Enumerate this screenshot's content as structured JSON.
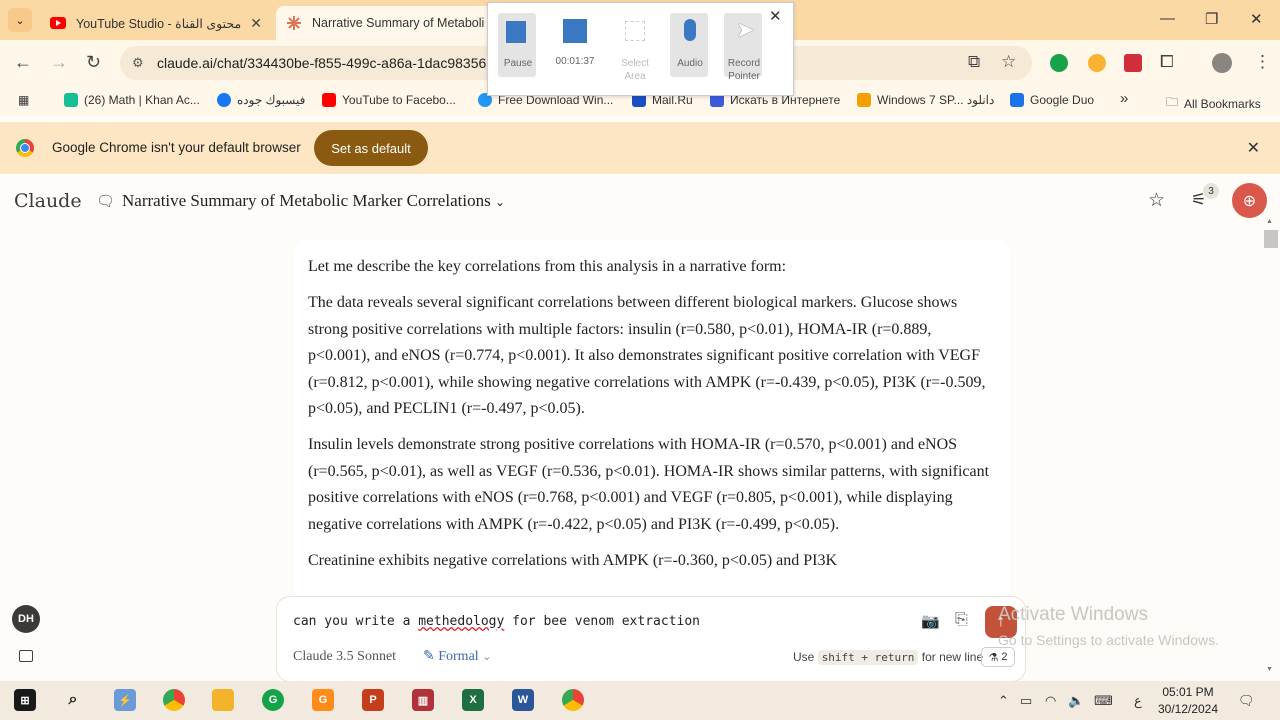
{
  "browser": {
    "tabs": [
      {
        "title": "YouTube Studio - محتوى القناة",
        "close": "✕"
      },
      {
        "title": "Narrative Summary of Metaboli",
        "close": "✕"
      }
    ],
    "url": "claude.ai/chat/334430be-f855-499c-a86a-1dac98356",
    "bookmarks": [
      "(26) Math | Khan Ac...",
      "فيسبوك جوده",
      "YouTube to Facebo...",
      "Free Download Win...",
      "Mail.Ru",
      "Искать в Интернете",
      "Windows 7 SP... دانلود",
      "Google Duo",
      "»",
      "All Bookmarks"
    ],
    "infobar": {
      "message": "Google Chrome isn't your default browser",
      "button": "Set as default"
    }
  },
  "recorder": {
    "pause": "Pause",
    "timer": "00:01:37",
    "select_area": "Select Area",
    "audio": "Audio",
    "record_pointer": "Record Pointer"
  },
  "app": {
    "logo": "Claude",
    "chat_title": "Narrative Summary of Metabolic Marker Correlations",
    "badge_count": "3"
  },
  "message": {
    "paragraphs": [
      "Let me describe the key correlations from this analysis in a narrative form:",
      "The data reveals several significant correlations between different biological markers. Glucose shows strong positive correlations with multiple factors: insulin (r=0.580, p<0.01), HOMA-IR (r=0.889, p<0.001), and eNOS (r=0.774, p<0.001). It also demonstrates significant positive correlation with VEGF (r=0.812, p<0.001), while showing negative correlations with AMPK (r=-0.439, p<0.05), PI3K (r=-0.509, p<0.05), and PECLIN1 (r=-0.497, p<0.05).",
      "Insulin levels demonstrate strong positive correlations with HOMA-IR (r=0.570, p<0.001) and eNOS (r=0.565, p<0.01), as well as VEGF (r=0.536, p<0.01). HOMA-IR shows similar patterns, with significant positive correlations with eNOS (r=0.768, p<0.001) and VEGF (r=0.805, p<0.001), while displaying negative correlations with AMPK (r=-0.422, p<0.05) and PI3K (r=-0.499, p<0.05).",
      "Creatinine exhibits negative correlations with AMPK (r=-0.360, p<0.05) and PI3K"
    ]
  },
  "composer": {
    "text_before": "can you write a ",
    "text_misspelled": "methedology",
    "text_after": " for bee venom extraction",
    "model": "Claude 3.5 Sonnet",
    "style": "Formal",
    "hint_prefix": "Use",
    "hint_key": "shift + return",
    "hint_suffix": "for new line",
    "prompt_count": "2"
  },
  "user": {
    "initials": "DH"
  },
  "watermark": {
    "title": "Activate Windows",
    "subtitle": "Go to Settings to activate Windows."
  },
  "taskbar": {
    "time": "05:01 PM",
    "date": "30/12/2024",
    "lang": "ع"
  }
}
